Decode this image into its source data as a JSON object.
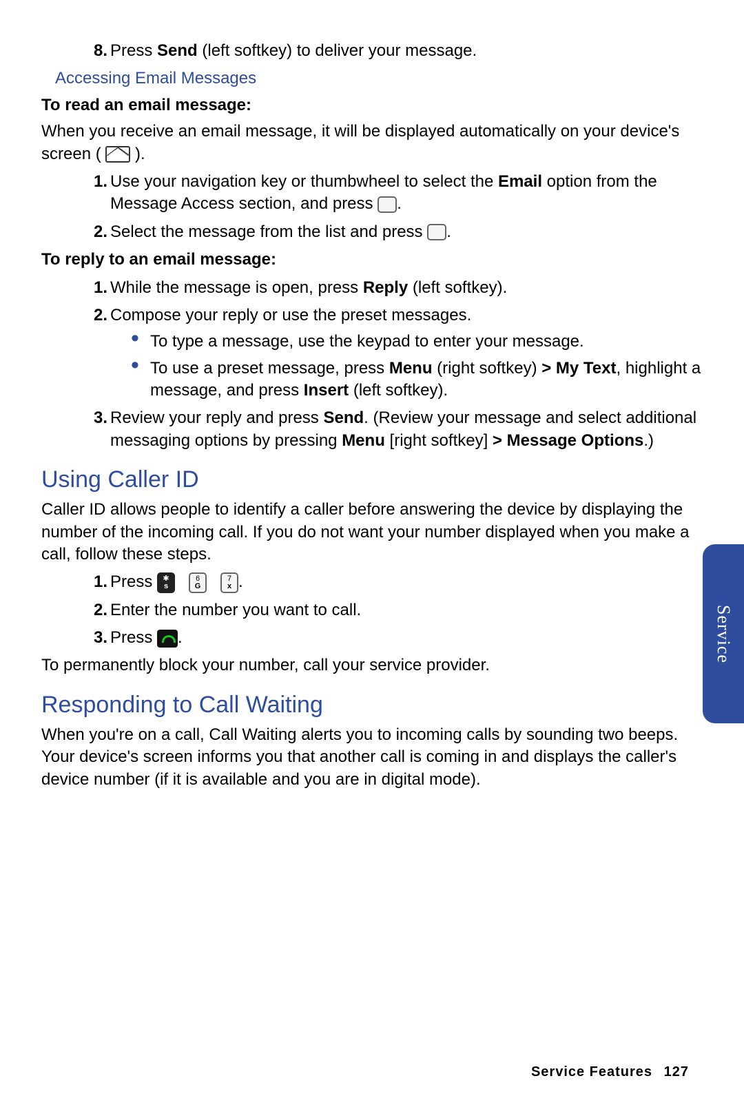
{
  "sideTab": "Service",
  "step8": {
    "num": "8.",
    "pre": "Press ",
    "b": "Send",
    "post": " (left softkey) to deliver your message."
  },
  "h_access": "Accessing Email Messages",
  "bold_read": "To read an email message:",
  "p_read_intro_pre": "When you receive an email message, it will be displayed automatically on your device's screen ( ",
  "p_read_intro_post": " ).",
  "read_s1": {
    "num": "1.",
    "pre": "Use your navigation key or thumbwheel to select the ",
    "b": "Email",
    "mid": " option from the Message Access section, and press ",
    "post": "."
  },
  "read_s2": {
    "num": "2.",
    "pre": "Select the message from the list and press ",
    "post": "."
  },
  "bold_reply": "To reply to an email message:",
  "reply_s1": {
    "num": "1.",
    "pre": "While the message is open, press ",
    "b": "Reply",
    "post": " (left softkey)."
  },
  "reply_s2": {
    "num": "2.",
    "text": "Compose your reply or use the preset messages."
  },
  "reply_s2_b1": "To type a message, use the keypad to enter your message.",
  "reply_s2_b2": {
    "pre": "To use a preset message, press ",
    "b1": "Menu",
    "mid1": " (right softkey) ",
    "gt": "> ",
    "b2": "My Text",
    "mid2": ", highlight a message, and press ",
    "b3": "Insert",
    "post": " (left softkey)."
  },
  "reply_s3": {
    "num": "3.",
    "pre": "Review your reply and press ",
    "b1": "Send",
    "mid1": ". (Review your message and select additional messaging options by pressing ",
    "b2": "Menu",
    "mid2": " [right softkey] ",
    "gt": "> ",
    "b3": "Message Options",
    "post": ".)"
  },
  "h_caller": "Using Caller ID",
  "p_caller": "Caller ID allows people to identify a caller before answering the device by displaying the number of the incoming call. If you do not want your number displayed when you make a call, follow these steps.",
  "cid_s1": {
    "num": "1.",
    "pre": "Press ",
    "post": "."
  },
  "cid_s2": {
    "num": "2.",
    "text": "Enter the number you want to call."
  },
  "cid_s3": {
    "num": "3.",
    "pre": "Press ",
    "post": "."
  },
  "p_block": "To permanently block your number, call your service provider.",
  "h_wait": "Responding to Call Waiting",
  "p_wait": "When you're on a call, Call Waiting alerts you to incoming calls by sounding two beeps. Your device's screen informs you that another call is coming in and displays the caller's device number (if it is available and you are in digital mode).",
  "keys": {
    "star": {
      "top": "✱",
      "bot": "s"
    },
    "six": {
      "top": "6",
      "bot": "G"
    },
    "seven": {
      "top": "7",
      "bot": "x"
    }
  },
  "footer": {
    "section": "Service Features",
    "page": "127"
  }
}
